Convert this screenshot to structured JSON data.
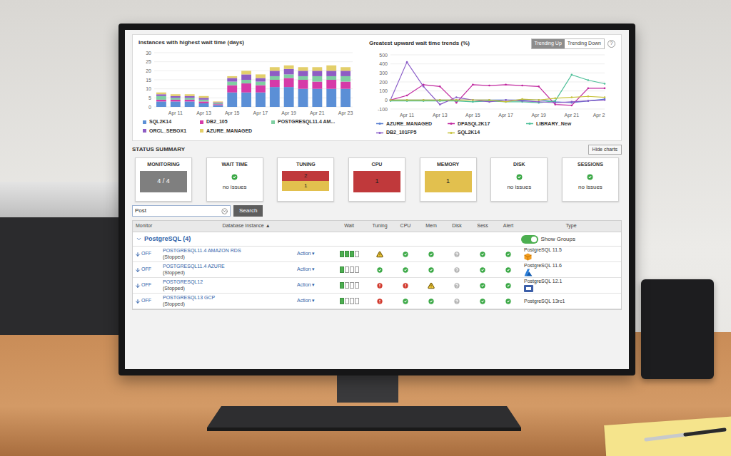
{
  "bar_chart": {
    "title": "Instances with highest wait time (days)",
    "y_ticks": [
      "30",
      "25",
      "20",
      "15",
      "10",
      "5",
      "0"
    ],
    "x_labels": [
      "Apr 11",
      "Apr 13",
      "Apr 15",
      "Apr 17",
      "Apr 19",
      "Apr 21",
      "Apr 23"
    ],
    "series": [
      {
        "name": "SQL2K14",
        "color": "#5b8fd6",
        "values": [
          3,
          3,
          3,
          2,
          1,
          8,
          8,
          8,
          11,
          11,
          10,
          10,
          10,
          10
        ]
      },
      {
        "name": "DB2_105",
        "color": "#d63aa8",
        "values": [
          1,
          1,
          1,
          1,
          0.5,
          4,
          5,
          4,
          4,
          5,
          5,
          4,
          5,
          4
        ]
      },
      {
        "name": "POSTGRESQL11.4 AM...",
        "color": "#7fcfa2",
        "values": [
          2,
          1,
          1,
          1,
          0.5,
          2,
          2,
          2,
          2,
          2,
          2,
          3,
          2,
          3
        ]
      },
      {
        "name": "ORCL_SEBOX1",
        "color": "#8e5cc4",
        "values": [
          1,
          1,
          1,
          1,
          0.5,
          2,
          3,
          2,
          3,
          3,
          3,
          3,
          3,
          3
        ]
      },
      {
        "name": "AZURE_MANAGED",
        "color": "#e3cf6a",
        "values": [
          1,
          1,
          1,
          1,
          0.5,
          1,
          2,
          2,
          2,
          2,
          2,
          2,
          3,
          2
        ]
      }
    ]
  },
  "line_chart": {
    "title": "Greatest upward wait time trends (%)",
    "y_ticks": [
      "500",
      "400",
      "300",
      "200",
      "100",
      "0",
      "-100"
    ],
    "x_labels": [
      "Apr 11",
      "Apr 13",
      "Apr 15",
      "Apr 17",
      "Apr 19",
      "Apr 21",
      "Apr 2"
    ],
    "toggle": [
      {
        "label": "Trending Up",
        "selected": true
      },
      {
        "label": "Trending Down",
        "selected": false
      }
    ],
    "help": "?",
    "series": [
      {
        "name": "AZURE_MANAGED",
        "color": "#5a7fd0",
        "values": [
          0,
          0,
          0,
          0,
          0,
          0,
          0,
          0,
          0,
          0,
          -20,
          -30,
          -10,
          10
        ]
      },
      {
        "name": "DPASQL2K17",
        "color": "#c0269e",
        "values": [
          0,
          50,
          170,
          150,
          -30,
          170,
          160,
          170,
          160,
          150,
          -50,
          -60,
          130,
          130
        ]
      },
      {
        "name": "LIBRARY_New",
        "color": "#4dbf98",
        "values": [
          -10,
          -10,
          -10,
          -10,
          -10,
          -20,
          -10,
          -20,
          -20,
          -30,
          -10,
          280,
          220,
          180
        ]
      },
      {
        "name": "DB2_101FP5",
        "color": "#8a5cc8",
        "values": [
          0,
          420,
          150,
          -50,
          30,
          0,
          -20,
          0,
          -10,
          -20,
          -30,
          -20,
          -10,
          0
        ]
      },
      {
        "name": "SQL2K14",
        "color": "#c7c23a",
        "values": [
          0,
          0,
          0,
          0,
          0,
          0,
          0,
          -20,
          10,
          0,
          20,
          30,
          40,
          30
        ]
      }
    ]
  },
  "status_summary": {
    "title": "STATUS SUMMARY",
    "hide_button": "Hide charts",
    "cards": [
      {
        "label": "MONITORING",
        "kind": "value",
        "value": "4 / 4",
        "color": "#7f7f7f"
      },
      {
        "label": "WAIT TIME",
        "kind": "ok",
        "text": "no issues"
      },
      {
        "label": "TUNING",
        "kind": "counts",
        "counts": [
          {
            "value": "2",
            "color": "#c0393b"
          },
          {
            "value": "1",
            "color": "#e2c04e"
          }
        ]
      },
      {
        "label": "CPU",
        "kind": "counts",
        "counts": [
          {
            "value": "1",
            "color": "#c0393b"
          }
        ]
      },
      {
        "label": "MEMORY",
        "kind": "counts",
        "counts": [
          {
            "value": "1",
            "color": "#e2c04e"
          }
        ]
      },
      {
        "label": "DISK",
        "kind": "ok",
        "text": "no issues"
      },
      {
        "label": "SESSIONS",
        "kind": "ok",
        "text": "no issues"
      }
    ]
  },
  "search": {
    "value": "Post",
    "button": "Search"
  },
  "table": {
    "columns": [
      "Monitor",
      "Database Instance ▲",
      "Wait",
      "Tuning",
      "CPU",
      "Mem",
      "Disk",
      "Sess",
      "Alert",
      "Type"
    ],
    "group": {
      "label": "PostgreSQL (4)",
      "expanded": true
    },
    "show_groups": {
      "label": "Show Groups",
      "on": true
    },
    "rows": [
      {
        "monitor": "OFF",
        "name": "POSTGRESQL11.4 AMAZON RDS",
        "state": "(Stopped)",
        "action": "Action ▾",
        "wait_level": 0.75,
        "statuses": [
          "warning",
          "ok",
          "ok",
          "unknown",
          "ok",
          "ok"
        ],
        "type": "PostgreSQL 11.5",
        "kind": "amazon"
      },
      {
        "monitor": "OFF",
        "name": "POSTGRESQL11.4 AZURE",
        "state": "(Stopped)",
        "action": "Action ▾",
        "wait_level": 0.25,
        "statuses": [
          "ok",
          "ok",
          "ok",
          "unknown",
          "ok",
          "ok"
        ],
        "type": "PostgreSQL 11.6",
        "kind": "azure"
      },
      {
        "monitor": "OFF",
        "name": "POSTGRESQL12",
        "state": "(Stopped)",
        "action": "Action ▾",
        "wait_level": 0.25,
        "statuses": [
          "error",
          "error",
          "warning",
          "unknown",
          "ok",
          "ok"
        ],
        "type": "PostgreSQL 12.1",
        "kind": "gcp"
      },
      {
        "monitor": "OFF",
        "name": "POSTGRESQL13 GCP",
        "state": "(Stopped)",
        "action": "Action ▾",
        "wait_level": 0.25,
        "statuses": [
          "error",
          "ok",
          "ok",
          "unknown",
          "ok",
          "ok"
        ],
        "type": "PostgreSQL 13rc1",
        "kind": "none"
      }
    ]
  }
}
